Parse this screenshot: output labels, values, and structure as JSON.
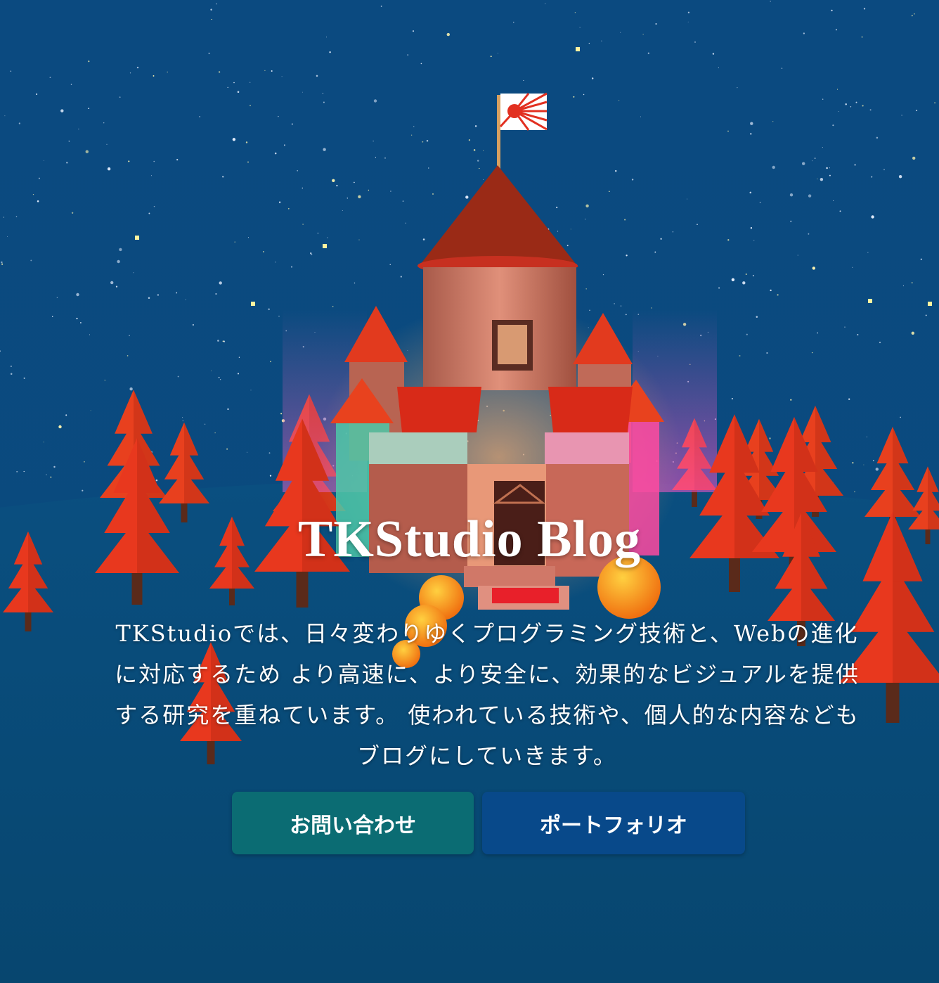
{
  "hero": {
    "title": "TKStudio Blog",
    "description": "TKStudioでは、日々変わりゆくプログラミング技術と、Webの進化に対応するため より高速に、より安全に、効果的なビジュアルを提供する研究を重ねています。 使われている技術や、個人的な内容などもブログにしていきます。"
  },
  "buttons": {
    "contact_label": "お問い合わせ",
    "portfolio_label": "ポートフォリオ"
  },
  "colors": {
    "sky": "#0a4a7e",
    "ground": "#074a7a",
    "tree": "#e8381e",
    "roof": "#9a2a16",
    "contact_button": "#0b6c73",
    "portfolio_button": "#08498a"
  },
  "scene": {
    "description_icons": [
      "castle",
      "flag",
      "trees",
      "stars"
    ]
  }
}
